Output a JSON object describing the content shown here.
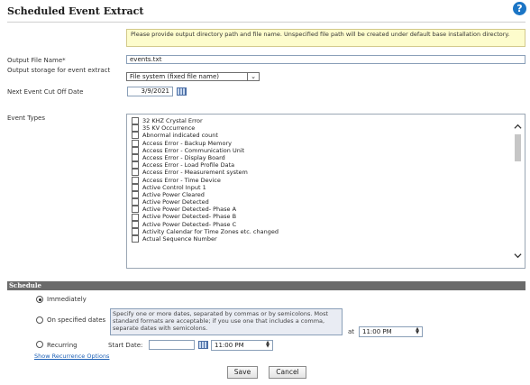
{
  "page": {
    "title": "Scheduled Event Extract",
    "help_symbol": "?"
  },
  "notice": "Please provide output directory path and file name. Unspecified file path will be created under default base installation directory.",
  "form": {
    "output_file_label": "Output File Name*",
    "output_file_value": "events.txt",
    "storage_label": "Output storage for event extract",
    "storage_value": "File system (fixed file name)",
    "cutoff_label": "Next Event Cut Off Date",
    "cutoff_value": "3/9/2021",
    "event_types_label": "Event Types"
  },
  "event_types": [
    "32 KHZ Crystal Error",
    "35 KV Occurrence",
    "Abnormal indicated count",
    "Access Error - Backup Memory",
    "Access Error - Communication Unit",
    "Access Error - Display Board",
    "Access Error - Load Profile Data",
    "Access Error - Measurement system",
    "Access Error - Time Device",
    "Active Control Input 1",
    "Active Power Cleared",
    "Active Power Detected",
    "Active Power Detected- Phase A",
    "Active Power Detected- Phase B",
    "Active Power Detected- Phase C",
    "Activity Calendar for Time Zones etc. changed",
    "Actual Sequence Number"
  ],
  "schedule": {
    "header": "Schedule",
    "immediately_label": "Immediately",
    "specified_label": "On specified dates",
    "specified_hint": "Specify one or more dates, separated by commas or by semicolons. Most standard formats are acceptable; if you use one that includes a comma, separate dates with semicolons.",
    "at_label": "at",
    "at_time": "11:00 PM",
    "recurring_label": "Recurring",
    "start_date_label": "Start Date:",
    "start_date_value": "",
    "start_time": "11:00 PM",
    "recurrence_link": "Show Recurrence Options",
    "selected": "immediately"
  },
  "buttons": {
    "save": "Save",
    "cancel": "Cancel"
  }
}
